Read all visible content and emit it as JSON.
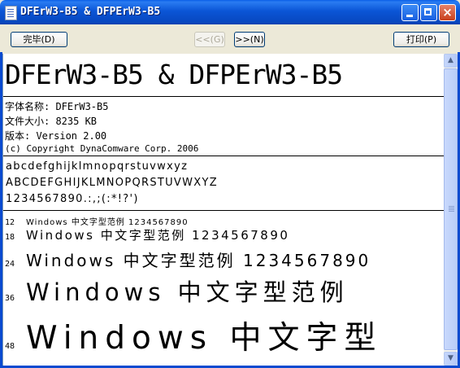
{
  "window": {
    "title": "DFErW3-B5 & DFPErW3-B5",
    "controls": {
      "minimize": "minimize",
      "maximize": "maximize",
      "close": "×"
    }
  },
  "toolbar": {
    "done_label": "完毕(D)",
    "prev_label": "<<(G)",
    "next_label": ">>(N)",
    "print_label": "打印(P)"
  },
  "preview": {
    "heading": "DFErW3-B5 & DFPErW3-B5",
    "info": {
      "font_name": "字体名称: DFErW3-B5",
      "file_size": "文件大小: 8235 KB",
      "version": "版本: Version 2.00",
      "copyright": "(c) Copyright DynaComware Corp. 2006"
    },
    "charset": {
      "lowercase": "abcdefghijklmnopqrstuvwxyz",
      "uppercase": "ABCDEFGHIJKLMNOPQRSTUVWXYZ",
      "digits_punct": "1234567890.:,;(:*!?')"
    },
    "samples": [
      {
        "size": "12",
        "text": "Windows 中文字型范例 1234567890"
      },
      {
        "size": "18",
        "text": "Windows 中文字型范例 1234567890"
      },
      {
        "size": "24",
        "text": "Windows 中文字型范例 1234567890"
      },
      {
        "size": "36",
        "text": "Windows 中文字型范例"
      },
      {
        "size": "48",
        "text": "Windows 中文字型"
      }
    ]
  },
  "scrollbar": {
    "up_arrow": "▲",
    "down_arrow": "▼"
  },
  "colors": {
    "titlebar_blue": "#0a55d6",
    "close_red": "#c8401c",
    "window_face": "#ece9d8",
    "scrollbar_blue": "#c5d6fb"
  }
}
